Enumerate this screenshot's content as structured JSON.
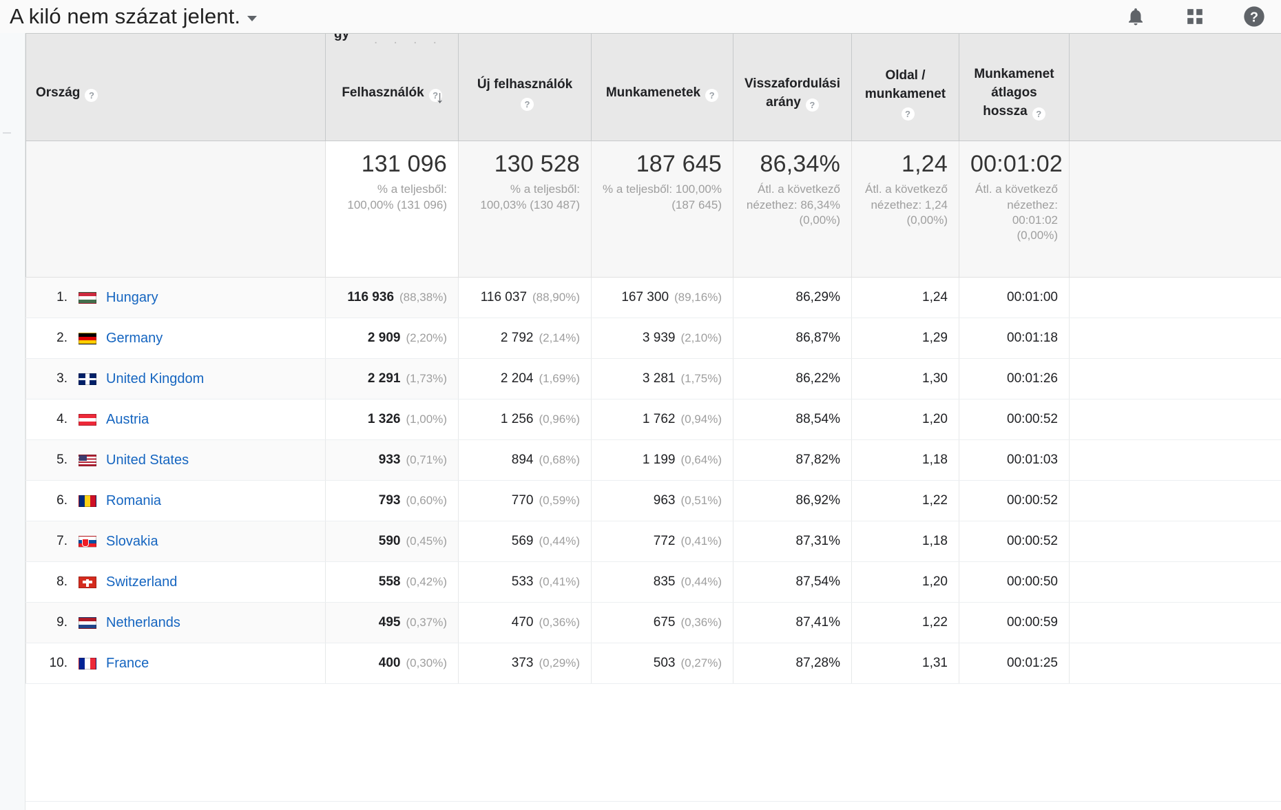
{
  "topbar": {
    "report_title": "A kiló nem százat jelent.",
    "caret_label": "▾",
    "icons": [
      {
        "name": "notifications-bell-icon",
        "label": "bell"
      },
      {
        "name": "apps-grid-icon",
        "label": "apps"
      },
      {
        "name": "help-question-icon",
        "label": "help"
      }
    ]
  },
  "table": {
    "clipped_group_label": "gy",
    "help_glyph": "?",
    "sort_arrow": "↓",
    "headers": {
      "dimension": "Ország",
      "m1": "Felhasználók",
      "m2": "Új felhasználók",
      "m3": "Munkamenetek",
      "m4": "Visszafordulási arány",
      "m5": "Oldal / munkamenet",
      "m6": "Munkamenet átlagos hossza"
    },
    "summary": {
      "m1": {
        "value": "131 096",
        "sub": "% a teljesből: 100,00% (131 096)"
      },
      "m2": {
        "value": "130 528",
        "sub": "% a teljesből: 100,03% (130 487)"
      },
      "m3": {
        "value": "187 645",
        "sub": "% a teljesből: 100,00% (187 645)"
      },
      "m4": {
        "value": "86,34%",
        "sub": "Átl. a következő nézethez: 86,34% (0,00%)"
      },
      "m5": {
        "value": "1,24",
        "sub": "Átl. a következő nézethez: 1,24 (0,00%)"
      },
      "m6": {
        "value": "00:01:02",
        "sub": "Átl. a következő nézethez: 00:01:02 (0,00%)"
      }
    },
    "rows": [
      {
        "rank": "1.",
        "country": "Hungary",
        "flag": "f-hu",
        "users": "116 936",
        "users_pct": "(88,38%)",
        "new_users": "116 037",
        "new_users_pct": "(88,90%)",
        "sessions": "167 300",
        "sessions_pct": "(89,16%)",
        "bounce": "86,29%",
        "pages": "1,24",
        "duration": "00:01:00"
      },
      {
        "rank": "2.",
        "country": "Germany",
        "flag": "f-de",
        "users": "2 909",
        "users_pct": "(2,20%)",
        "new_users": "2 792",
        "new_users_pct": "(2,14%)",
        "sessions": "3 939",
        "sessions_pct": "(2,10%)",
        "bounce": "86,87%",
        "pages": "1,29",
        "duration": "00:01:18"
      },
      {
        "rank": "3.",
        "country": "United Kingdom",
        "flag": "f-gb",
        "users": "2 291",
        "users_pct": "(1,73%)",
        "new_users": "2 204",
        "new_users_pct": "(1,69%)",
        "sessions": "3 281",
        "sessions_pct": "(1,75%)",
        "bounce": "86,22%",
        "pages": "1,30",
        "duration": "00:01:26"
      },
      {
        "rank": "4.",
        "country": "Austria",
        "flag": "f-at",
        "users": "1 326",
        "users_pct": "(1,00%)",
        "new_users": "1 256",
        "new_users_pct": "(0,96%)",
        "sessions": "1 762",
        "sessions_pct": "(0,94%)",
        "bounce": "88,54%",
        "pages": "1,20",
        "duration": "00:00:52"
      },
      {
        "rank": "5.",
        "country": "United States",
        "flag": "f-us",
        "users": "933",
        "users_pct": "(0,71%)",
        "new_users": "894",
        "new_users_pct": "(0,68%)",
        "sessions": "1 199",
        "sessions_pct": "(0,64%)",
        "bounce": "87,82%",
        "pages": "1,18",
        "duration": "00:01:03"
      },
      {
        "rank": "6.",
        "country": "Romania",
        "flag": "f-ro",
        "users": "793",
        "users_pct": "(0,60%)",
        "new_users": "770",
        "new_users_pct": "(0,59%)",
        "sessions": "963",
        "sessions_pct": "(0,51%)",
        "bounce": "86,92%",
        "pages": "1,22",
        "duration": "00:00:52"
      },
      {
        "rank": "7.",
        "country": "Slovakia",
        "flag": "f-sk",
        "users": "590",
        "users_pct": "(0,45%)",
        "new_users": "569",
        "new_users_pct": "(0,44%)",
        "sessions": "772",
        "sessions_pct": "(0,41%)",
        "bounce": "87,31%",
        "pages": "1,18",
        "duration": "00:00:52"
      },
      {
        "rank": "8.",
        "country": "Switzerland",
        "flag": "f-ch",
        "users": "558",
        "users_pct": "(0,42%)",
        "new_users": "533",
        "new_users_pct": "(0,41%)",
        "sessions": "835",
        "sessions_pct": "(0,44%)",
        "bounce": "87,54%",
        "pages": "1,20",
        "duration": "00:00:50"
      },
      {
        "rank": "9.",
        "country": "Netherlands",
        "flag": "f-nl",
        "users": "495",
        "users_pct": "(0,37%)",
        "new_users": "470",
        "new_users_pct": "(0,36%)",
        "sessions": "675",
        "sessions_pct": "(0,36%)",
        "bounce": "87,41%",
        "pages": "1,22",
        "duration": "00:00:59"
      },
      {
        "rank": "10.",
        "country": "France",
        "flag": "f-fr",
        "users": "400",
        "users_pct": "(0,30%)",
        "new_users": "373",
        "new_users_pct": "(0,29%)",
        "sessions": "503",
        "sessions_pct": "(0,27%)",
        "bounce": "87,28%",
        "pages": "1,31",
        "duration": "00:01:25"
      }
    ]
  },
  "colors": {
    "link": "#1565c0",
    "header_bg": "#e8e8e8",
    "muted": "#9e9e9e",
    "topbar_bg": "#fafafa"
  }
}
